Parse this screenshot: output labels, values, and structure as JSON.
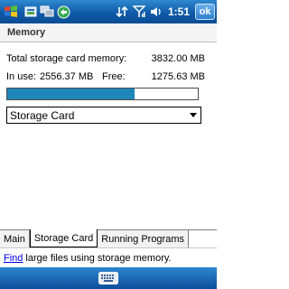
{
  "status_bar": {
    "clock": "1:51",
    "ok_label": "ok",
    "icons": [
      "windows-start-icon",
      "app-icon",
      "network-icon",
      "sync-icon",
      "connectivity-icon",
      "signal-icon",
      "volume-icon"
    ]
  },
  "header": {
    "title": "Memory"
  },
  "storage": {
    "total_label": "Total storage card memory:",
    "total_value": "3832.00 MB",
    "in_use_label": "In use:",
    "in_use_value": "2556.37 MB",
    "free_label": "Free:",
    "free_value": "1275.63 MB",
    "usage_fraction": 0.667
  },
  "dropdown": {
    "selected": "Storage Card"
  },
  "tabs": [
    {
      "label": "Main",
      "active": false
    },
    {
      "label": "Storage Card",
      "active": true
    },
    {
      "label": "Running Programs",
      "active": false
    }
  ],
  "footer": {
    "link_text": "Find",
    "text": "large files using storage memory."
  },
  "colors": {
    "titlebar": "#0f5aa8",
    "progress_fill": "#1e86b8",
    "link": "#0000ee"
  }
}
